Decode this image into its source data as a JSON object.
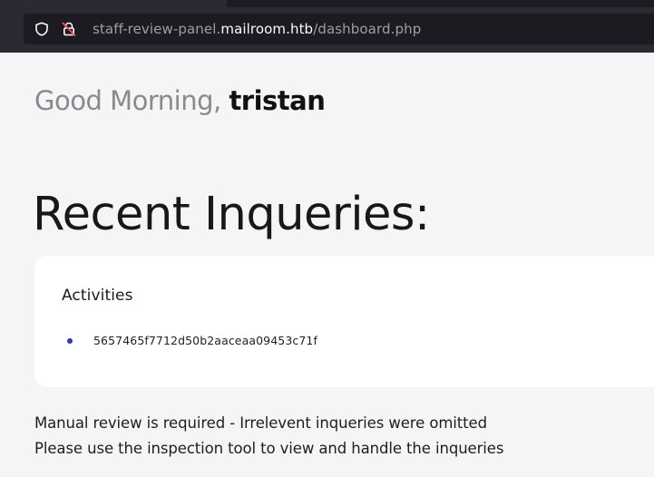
{
  "browser": {
    "url_prefix": "staff-review-panel.",
    "url_domain": "mailroom.htb",
    "url_path": "/dashboard.php"
  },
  "page": {
    "greeting_prefix": "Good Morning, ",
    "greeting_user": "tristan",
    "section_title": "Recent Inqueries:",
    "card": {
      "heading": "Activities",
      "items": [
        {
          "label": "5657465f7712d50b2aaceaa09453c71f"
        }
      ]
    },
    "notices": [
      "Manual review is required - Irrelevent inqueries were omitted",
      "Please use the inspection tool to view and handle the inqueries"
    ]
  },
  "colors": {
    "bullet": "#2b3bb5",
    "background": "#f4f5f7",
    "urlbar": "#2b2a33"
  },
  "icons": {
    "tracking_protection": "shield-icon",
    "connection": "insecure-lock-icon"
  }
}
